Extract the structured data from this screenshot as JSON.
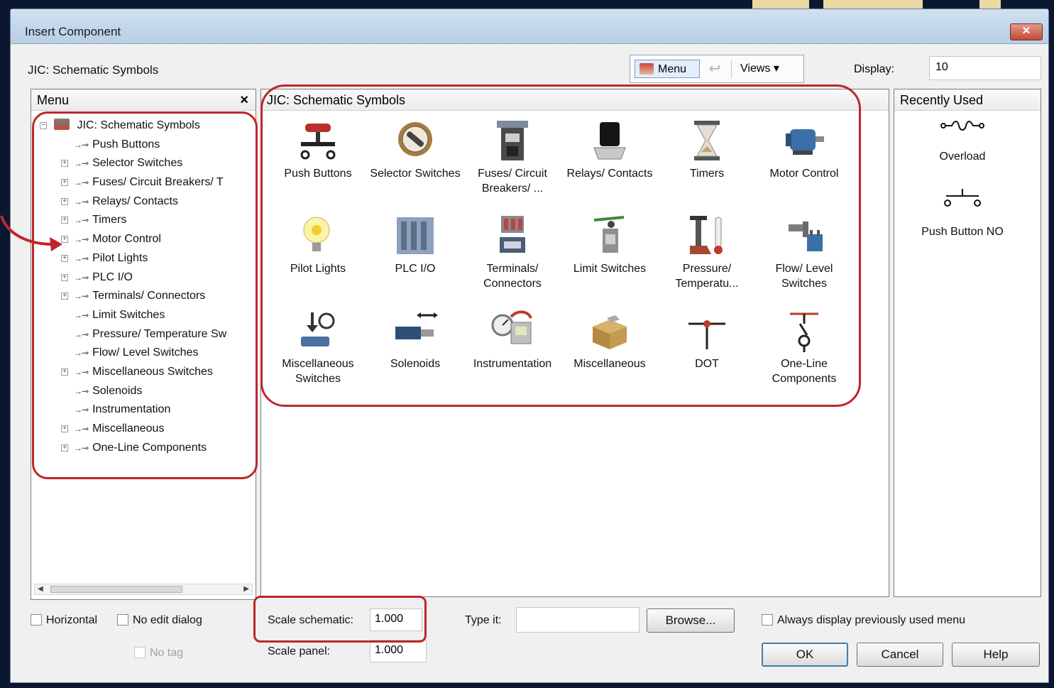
{
  "dialog": {
    "title": "Insert Component",
    "close_glyph": "✕",
    "library_title": "JIC: Schematic Symbols",
    "toolbar": {
      "menu_label": "Menu",
      "views_label": "Views ▾"
    },
    "display": {
      "label": "Display:",
      "value": "10"
    }
  },
  "menu_panel": {
    "title": "Menu",
    "close_glyph": "×",
    "root": "JIC: Schematic Symbols",
    "items": [
      {
        "label": "Push Buttons",
        "expandable": false
      },
      {
        "label": "Selector Switches",
        "expandable": true
      },
      {
        "label": "Fuses/ Circuit Breakers/ T",
        "expandable": true
      },
      {
        "label": "Relays/ Contacts",
        "expandable": true
      },
      {
        "label": "Timers",
        "expandable": true
      },
      {
        "label": "Motor Control",
        "expandable": true
      },
      {
        "label": "Pilot Lights",
        "expandable": true
      },
      {
        "label": "PLC I/O",
        "expandable": true
      },
      {
        "label": "Terminals/ Connectors",
        "expandable": true
      },
      {
        "label": "Limit Switches",
        "expandable": false
      },
      {
        "label": "Pressure/ Temperature Sw",
        "expandable": false
      },
      {
        "label": "Flow/ Level Switches",
        "expandable": false
      },
      {
        "label": "Miscellaneous Switches",
        "expandable": true
      },
      {
        "label": "Solenoids",
        "expandable": false
      },
      {
        "label": "Instrumentation",
        "expandable": false
      },
      {
        "label": "Miscellaneous",
        "expandable": true
      },
      {
        "label": "One-Line Components",
        "expandable": true
      }
    ]
  },
  "symbols_panel": {
    "title": "JIC: Schematic Symbols",
    "tiles": [
      {
        "label": "Push Buttons",
        "icon": "push-button-icon"
      },
      {
        "label": "Selector Switches",
        "icon": "selector-switch-icon"
      },
      {
        "label": "Fuses/ Circuit Breakers/ ...",
        "icon": "circuit-breaker-icon"
      },
      {
        "label": "Relays/ Contacts",
        "icon": "relay-icon"
      },
      {
        "label": "Timers",
        "icon": "hourglass-icon"
      },
      {
        "label": "Motor Control",
        "icon": "motor-icon"
      },
      {
        "label": "Pilot Lights",
        "icon": "light-bulb-icon"
      },
      {
        "label": "PLC I/O",
        "icon": "plc-icon"
      },
      {
        "label": "Terminals/ Connectors",
        "icon": "terminal-block-icon"
      },
      {
        "label": "Limit Switches",
        "icon": "limit-switch-icon"
      },
      {
        "label": "Pressure/ Temperatu...",
        "icon": "thermometer-icon"
      },
      {
        "label": "Flow/ Level Switches",
        "icon": "faucet-icon"
      },
      {
        "label": "Miscellaneous Switches",
        "icon": "misc-switch-icon"
      },
      {
        "label": "Solenoids",
        "icon": "solenoid-icon"
      },
      {
        "label": "Instrumentation",
        "icon": "gauge-icon"
      },
      {
        "label": "Miscellaneous",
        "icon": "boxes-icon"
      },
      {
        "label": "DOT",
        "icon": "dot-junction-icon"
      },
      {
        "label": "One-Line Components",
        "icon": "one-line-icon"
      }
    ]
  },
  "recent_panel": {
    "title": "Recently Used",
    "items": [
      {
        "label": "Overload",
        "icon": "overload-symbol-icon"
      },
      {
        "label": "Push Button NO",
        "icon": "push-button-no-symbol-icon"
      }
    ]
  },
  "options": {
    "horizontal": "Horizontal",
    "no_edit_dialog": "No edit dialog",
    "no_tag": "No tag",
    "scale_schematic_label": "Scale schematic:",
    "scale_schematic_value": "1.000",
    "scale_panel_label": "Scale panel:",
    "scale_panel_value": "1.000",
    "type_it_label": "Type it:",
    "type_it_value": "",
    "browse": "Browse...",
    "always_display": "Always display previously used menu",
    "ok": "OK",
    "cancel": "Cancel",
    "help": "Help"
  },
  "colors": {
    "annotation": "#c0262a",
    "background": "#0b1730",
    "title_bar": "#c7dbef"
  }
}
